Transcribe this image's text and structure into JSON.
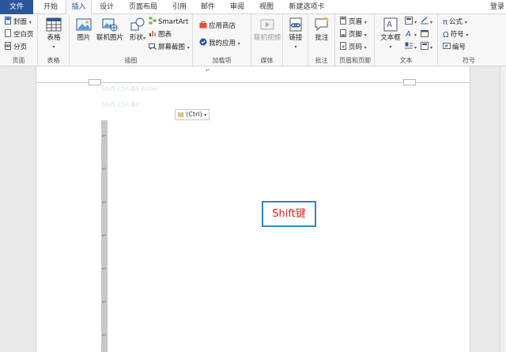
{
  "tabs": {
    "file": "文件",
    "home": "开始",
    "insert": "插入",
    "design": "设计",
    "layout": "页面布局",
    "references": "引用",
    "mailings": "邮件",
    "review": "审阅",
    "view": "视图",
    "new_tab": "新建选项卡",
    "login": "登录"
  },
  "ribbon": {
    "pages": {
      "cover": "封面",
      "blank": "空白页",
      "break": "分页",
      "label": "页面"
    },
    "table": {
      "table": "表格",
      "label": "表格"
    },
    "illustrations": {
      "picture": "图片",
      "online_picture": "联机图片",
      "shapes": "形状",
      "smartart": "SmartArt",
      "chart": "图表",
      "screenshot": "屏幕截图",
      "label": "插图"
    },
    "addins": {
      "store": "应用商店",
      "my_apps": "我的应用",
      "label": "加载项"
    },
    "media": {
      "online_video": "联机视频",
      "label": "媒体"
    },
    "links": {
      "link": "链接",
      "label": ""
    },
    "comments": {
      "comment": "批注",
      "label": "批注"
    },
    "header_footer": {
      "header": "页眉",
      "footer": "页脚",
      "page_number": "页码",
      "label": "页眉和页脚"
    },
    "text": {
      "textbox": "文本框",
      "label": "文本"
    },
    "symbols": {
      "equation": "公式",
      "symbol": "符号",
      "number": "编号",
      "label": "符号"
    }
  },
  "document": {
    "paste_options": "(Ctrl)",
    "para_mark": "↵",
    "ghost_line_1": "Shift Ctrl Alt Enter",
    "ghost_line_2": "Shift Ctrl Alt",
    "annotation": "Shift键"
  },
  "colors": {
    "accent": "#2b579a",
    "annotation_text": "#e02020",
    "annotation_border": "#2e86c1"
  }
}
